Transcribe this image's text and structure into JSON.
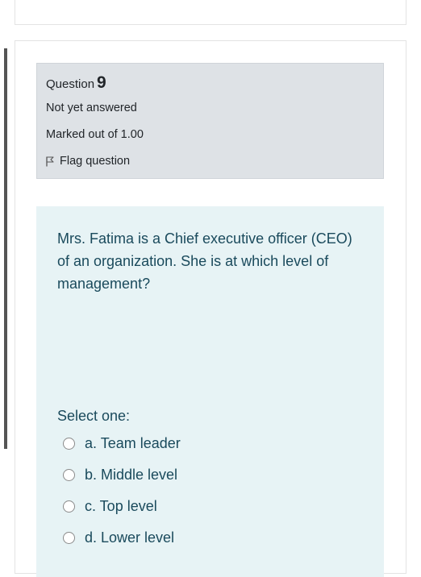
{
  "question": {
    "title_label": "Question",
    "number": "9",
    "state": "Not yet answered",
    "grade": "Marked out of 1.00",
    "flag_label": "Flag question",
    "text": "Mrs. Fatima is a Chief executive officer (CEO) of an organization. She is at which level of management?",
    "prompt": "Select one:",
    "options": [
      {
        "label": "a. Team leader"
      },
      {
        "label": "b. Middle level"
      },
      {
        "label": "c. Top level"
      },
      {
        "label": "d. Lower level"
      }
    ]
  },
  "colors": {
    "info_bg": "#dee2e6",
    "content_bg": "#e7f3f5",
    "question_text": "#1a4a5c"
  },
  "icons": {
    "flag": "flag-outline-icon",
    "radio": "radio-unchecked-icon"
  }
}
